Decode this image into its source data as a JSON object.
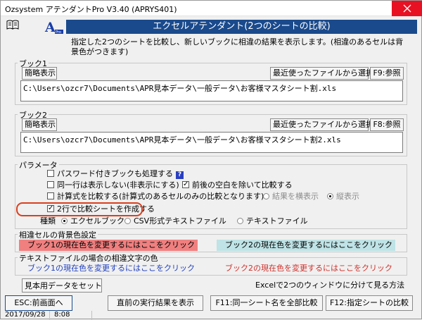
{
  "window": {
    "title": "Ozsystem アテンダントPro V3.40 (APRYS401)"
  },
  "header": {
    "title": "エクセルアテンダント(2つのシートの比較)"
  },
  "description": "指定した2つのシートを比較し、新しいブックに相違の結果を表示します。(相違のあるセルは背景色がつきます)",
  "book1": {
    "label": "ブック1",
    "simple_view": "簡略表示",
    "recent_files": "最近使ったファイルから選択",
    "browse": "F9:参照",
    "path": "C:\\Users\\ozcr7\\Documents\\APR見本データ\\一般データ\\お客様マスタシート割.xls"
  },
  "book2": {
    "label": "ブック2",
    "simple_view": "簡略表示",
    "recent_files": "最近使ったファイルから選択",
    "browse": "F8:参照",
    "path": "C:\\Users\\ozcr7\\Documents\\APR見本データ\\一般データ\\お客様マスタシート割2.xls"
  },
  "params": {
    "label": "パラメータ",
    "password_books": "パスワード付きブックも処理する",
    "hide_same_rows": "同一行は表示しない(非表示にする)",
    "trim_spaces": "前後の空白を除いて比較する",
    "compare_formulas": "計算式を比較する(計算式のあるセルのみの比較となります)",
    "result_horizontal": "結果を横表示",
    "result_vertical": "縦表示",
    "two_rows": "2行で比較シートを作成する",
    "type_label": "種類",
    "type_excel": "エクセルブック",
    "type_csv": "CSV形式テキストファイル",
    "type_text": "テキストファイル"
  },
  "diff_bg": {
    "label": "相違セルの背景色設定",
    "book1_prompt": "ブック1の現在色を変更するにはここをクリック",
    "book2_prompt": "ブック2の現在色を変更するにはここをクリック",
    "book1_color": "#f08080",
    "book2_color": "#bfe3e6"
  },
  "diff_text": {
    "label": "テキストファイルの場合の相違文字の色",
    "book1_prompt": "ブック1の現在色を変更するにはここをクリック",
    "book2_prompt": "ブック2の現在色を変更するにはここをクリック",
    "book1_color": "#1f3fbf",
    "book2_color": "#d0302a"
  },
  "buttons": {
    "sample_data": "見本用データをセット",
    "split_hint": "Excelで2つのウィンドウに分けて見る方法",
    "esc_back": "ESC:前画面へ",
    "prev_result": "直前の実行結果を表示",
    "f11_compare_all": "F11:同一シート名を全部比較",
    "f12_compare_selected": "F12:指定シートの比較"
  },
  "status": {
    "date": "2017/09/28",
    "time": "8:08"
  },
  "icons": {
    "book": "book-icon",
    "logo": "apr-logo-icon",
    "close": "close-icon",
    "help": "help-icon"
  }
}
